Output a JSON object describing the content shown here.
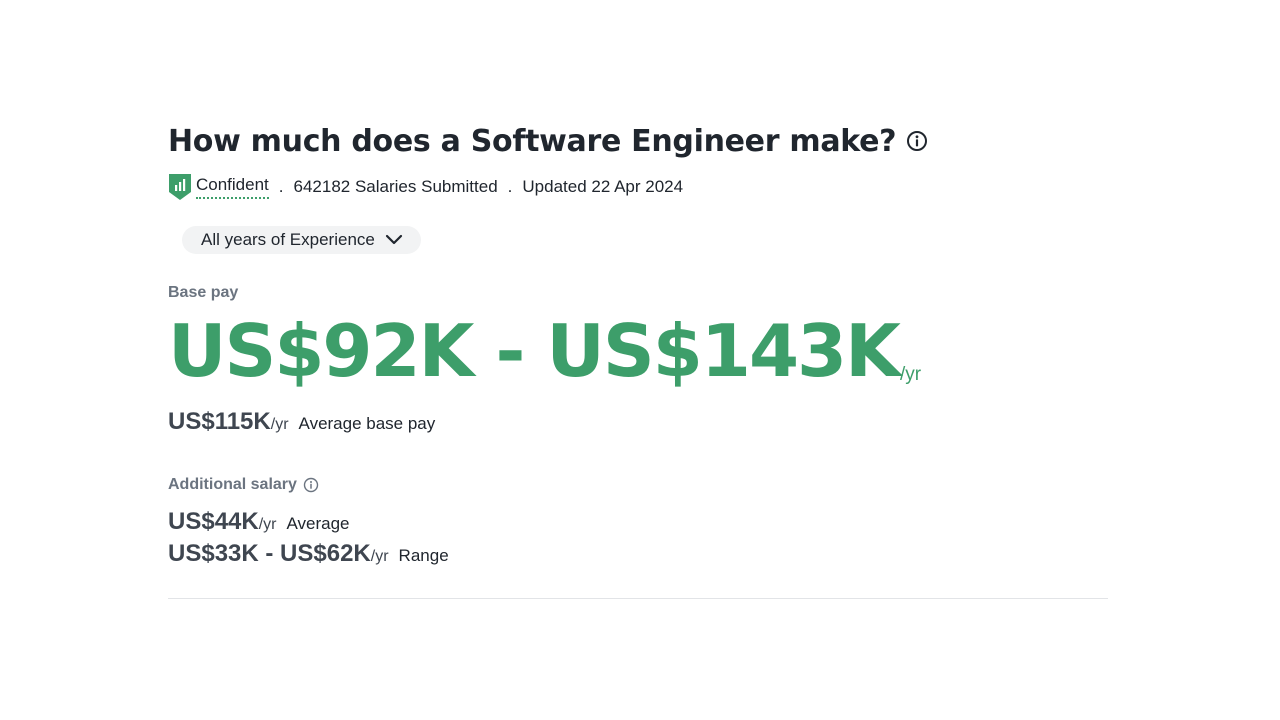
{
  "header": {
    "title": "How much does a Software Engineer make?"
  },
  "meta": {
    "confidence": "Confident",
    "separator": ".",
    "salaries_submitted": "642182 Salaries Submitted",
    "updated": "Updated 22 Apr 2024"
  },
  "filter": {
    "experience_label": "All years of Experience"
  },
  "base_pay": {
    "label": "Base pay",
    "range": "US$92K - US$143K",
    "range_unit": "/yr",
    "average_value": "US$115K",
    "average_unit": "/yr",
    "average_desc": "Average base pay"
  },
  "additional_salary": {
    "label": "Additional salary",
    "average_value": "US$44K",
    "average_unit": "/yr",
    "average_desc": "Average",
    "range_value": "US$33K - US$62K",
    "range_unit": "/yr",
    "range_desc": "Range"
  },
  "icons": {
    "title_info": "info-icon",
    "confidence": "shield-bar-chart-icon",
    "dropdown": "chevron-down-icon",
    "additional_info": "info-icon"
  },
  "colors": {
    "accent_green": "#3d9e6a",
    "text_dark": "#20262e",
    "label_gray": "#6b7480",
    "pill_bg": "#f2f3f4"
  }
}
